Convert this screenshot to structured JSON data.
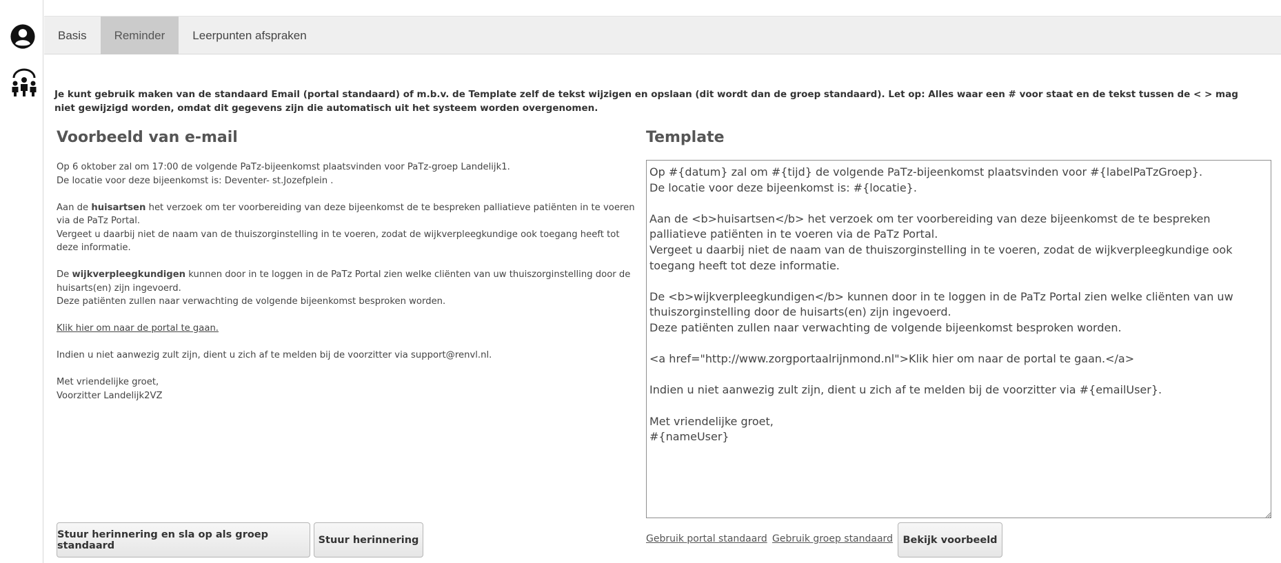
{
  "tabs": [
    "Basis",
    "Reminder",
    "Leerpunten afspraken"
  ],
  "active_tab": "Reminder",
  "icons": {
    "user": "user-circle-icon",
    "group": "group-people-icon"
  },
  "notice": "Je kunt gebruik maken van de standaard Email (portal standaard) of m.b.v. de Template zelf de tekst wijzigen en opslaan (dit wordt dan de groep standaard). Let op: Alles waar een # voor staat en de tekst tussen de < > mag niet gewijzigd worden, omdat dit gegevens zijn die automatisch uit het systeem worden overgenomen.",
  "preview": {
    "title": "Voorbeeld van e-mail",
    "line1": "Op 6 oktober zal om 17:00 de volgende PaTz-bijeenkomst plaatsvinden voor PaTz-groep Landelijk1.",
    "line2": "De locatie voor deze bijeenkomst is: Deventer- st.Jozefplein .",
    "p2_pre": "Aan de ",
    "p2_bold": "huisartsen",
    "p2_post": " het verzoek om ter voorbereiding van deze bijeenkomst de te bespreken palliatieve patiënten in te voeren via de PaTz Portal.",
    "p2_line2": "Vergeet u daarbij niet de naam van de thuiszorginstelling in te voeren, zodat de wijkverpleegkundige ook toegang heeft tot deze informatie.",
    "p3_pre": "De ",
    "p3_bold": "wijkverpleegkundigen",
    "p3_post": " kunnen door in te loggen in de PaTz Portal zien welke cliënten van uw thuiszorginstelling door de huisarts(en) zijn ingevoerd.",
    "p3_line2": "Deze patiënten zullen naar verwachting de volgende bijeenkomst besproken worden.",
    "link": "Klik hier om naar de portal te gaan.",
    "absence": "Indien u niet aanwezig zult zijn, dient u zich af te melden bij de voorzitter via support@renvl.nl.",
    "greeting": "Met vriendelijke groet,",
    "signature": "Voorzitter Landelijk2VZ"
  },
  "template": {
    "title": "Template",
    "text": "Op #{datum} zal om #{tijd} de volgende PaTz-bijeenkomst plaatsvinden voor #{labelPaTzGroep}.\nDe locatie voor deze bijeenkomst is: #{locatie}.\n\nAan de <b>huisartsen</b> het verzoek om ter voorbereiding van deze bijeenkomst de te bespreken palliatieve patiënten in te voeren via de PaTz Portal.\nVergeet u daarbij niet de naam van de thuiszorginstelling in te voeren, zodat de wijkverpleegkundige ook toegang heeft tot deze informatie.\n\nDe <b>wijkverpleegkundigen</b> kunnen door in te loggen in de PaTz Portal zien welke cliënten van uw thuiszorginstelling door de huisarts(en) zijn ingevoerd.\nDeze patiënten zullen naar verwachting de volgende bijeenkomst besproken worden.\n\n<a href=\"http://www.zorgportaalrijnmond.nl\">Klik hier om naar de portal te gaan.</a>\n\nIndien u niet aanwezig zult zijn, dient u zich af te melden bij de voorzitter via #{emailUser}.\n\nMet vriendelijke groet,\n#{nameUser}"
  },
  "buttons": {
    "send_save": "Stuur herinnering en sla op als groep standaard",
    "send": "Stuur herinnering",
    "preview": "Bekijk voorbeeld"
  },
  "links": {
    "portal_default": "Gebruik portal standaard",
    "group_default": "Gebruik groep standaard"
  }
}
